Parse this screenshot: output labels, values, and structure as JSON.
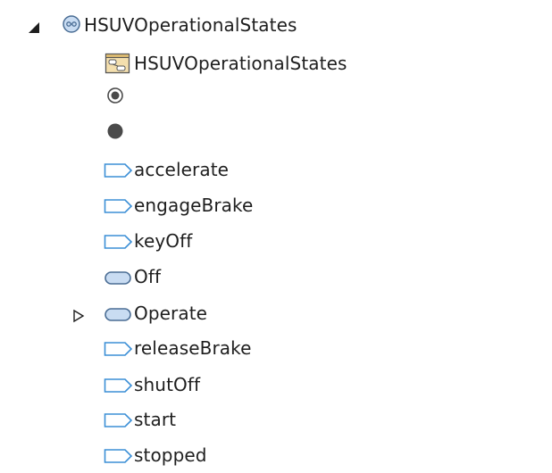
{
  "tree": {
    "root": {
      "label": "HSUVOperationalStates",
      "icon": "state-machine-icon",
      "expanded": true
    },
    "children": [
      {
        "label": "HSUVOperationalStates",
        "icon": "state-machine-diagram-icon"
      },
      {
        "label": "",
        "icon": "initial-pseudostate-icon"
      },
      {
        "label": "",
        "icon": "final-state-icon"
      },
      {
        "label": "accelerate",
        "icon": "signal-icon"
      },
      {
        "label": "engageBrake",
        "icon": "signal-icon"
      },
      {
        "label": "keyOff",
        "icon": "signal-icon"
      },
      {
        "label": "Off",
        "icon": "state-icon"
      },
      {
        "label": "Operate",
        "icon": "state-icon",
        "expandable": true,
        "expanded": false
      },
      {
        "label": "releaseBrake",
        "icon": "signal-icon"
      },
      {
        "label": "shutOff",
        "icon": "signal-icon"
      },
      {
        "label": "start",
        "icon": "signal-icon"
      },
      {
        "label": "stopped",
        "icon": "signal-icon"
      }
    ]
  },
  "colors": {
    "signal_stroke": "#3b8fd6",
    "signal_fill": "#ffffff",
    "state_stroke": "#4a6d94",
    "state_fill": "#c9dcf2",
    "dark_dot": "#4a4a4a",
    "text": "#1e1e1e"
  }
}
